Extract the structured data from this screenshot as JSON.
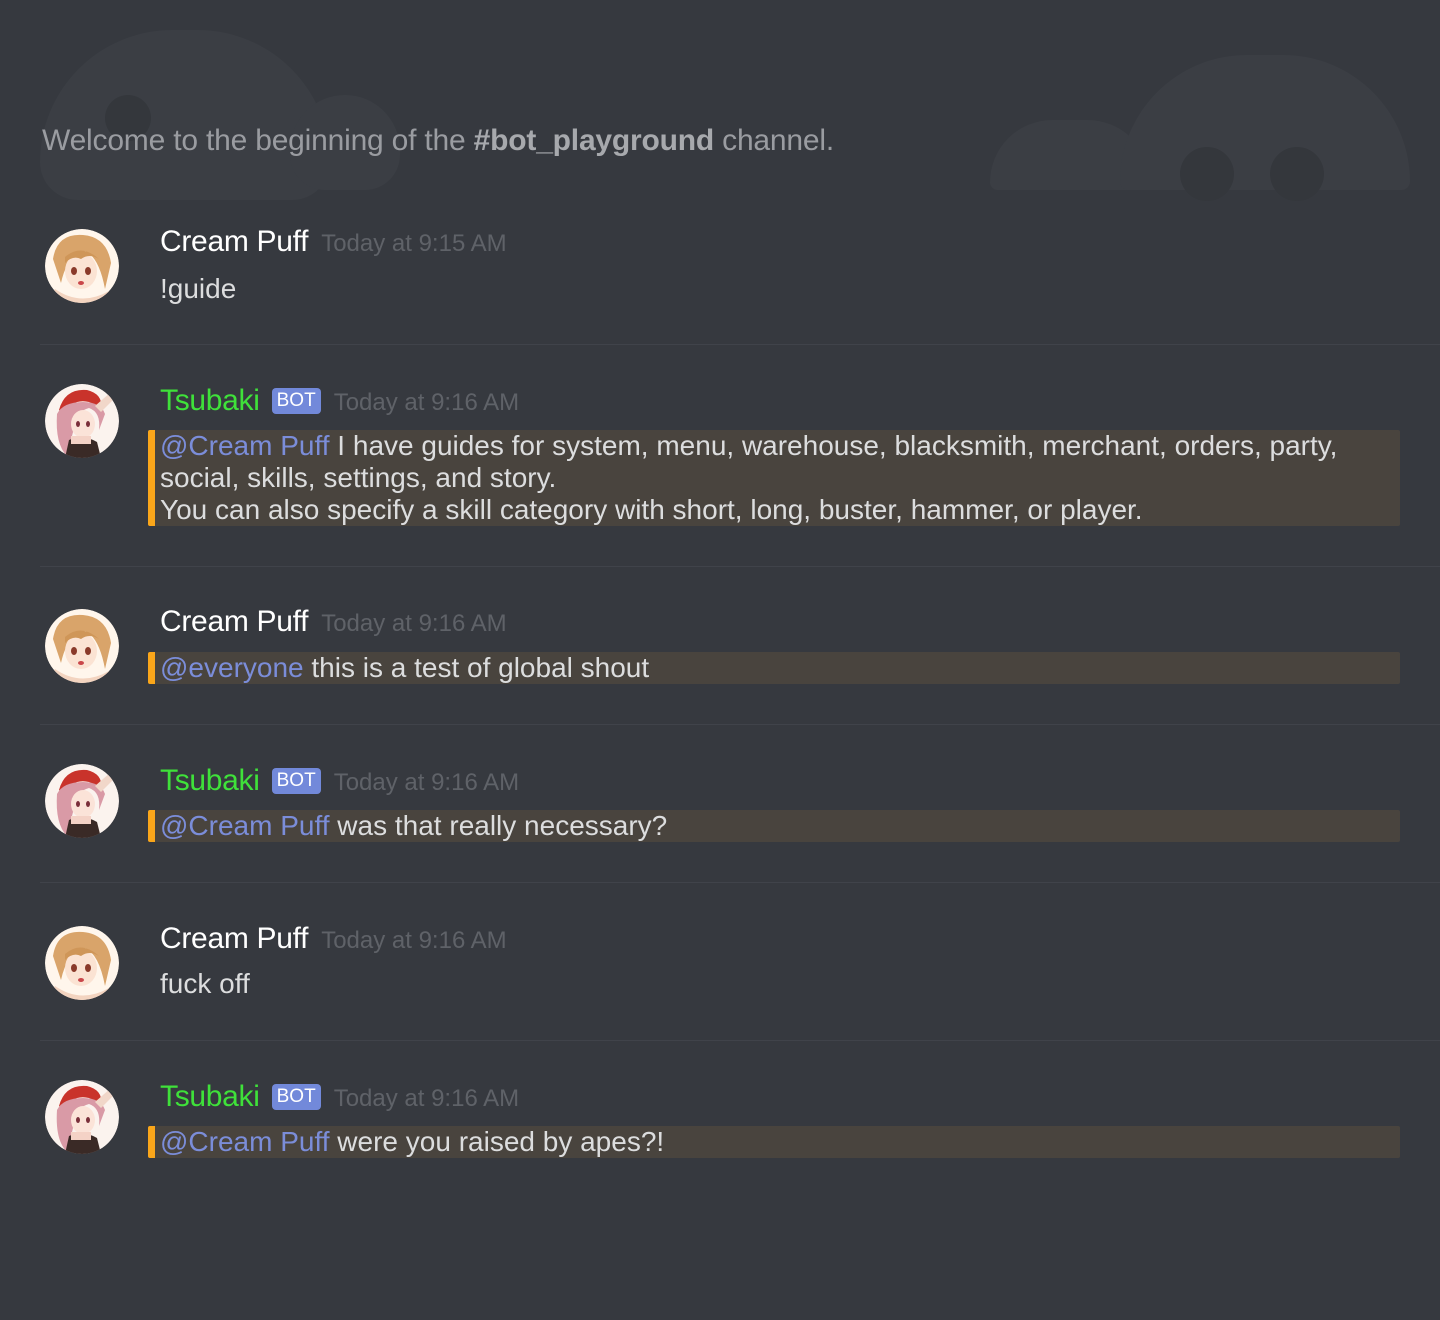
{
  "channel": {
    "welcome_prefix": "Welcome to the beginning of the ",
    "channel_name": "#bot_playground",
    "welcome_suffix": " channel."
  },
  "colors": {
    "background": "#36393f",
    "bot_name": "#3fe13a",
    "bot_tag": "#7289da",
    "mention": "#7b8dd9",
    "highlight_bar": "#faa61a",
    "highlight_bg": "#49443e"
  },
  "messages": [
    {
      "author": "Cream Puff",
      "avatar": "cream-puff-avatar",
      "timestamp": "Today at 9:15 AM",
      "text": "!guide"
    },
    {
      "author": "Tsubaki",
      "bot_tag": "BOT",
      "avatar": "tsubaki-avatar",
      "timestamp": "Today at 9:16 AM",
      "mention": "@Cream Puff",
      "line1": " I have guides for system, menu, warehouse, blacksmith, merchant, orders, party,",
      "line2": "social, skills, settings, and story.",
      "line3": "You can also specify a skill category with short, long, buster, hammer, or player."
    },
    {
      "author": "Cream Puff",
      "avatar": "cream-puff-avatar",
      "timestamp": "Today at 9:16 AM",
      "mention": "@everyone",
      "text": " this is a test of global shout"
    },
    {
      "author": "Tsubaki",
      "bot_tag": "BOT",
      "avatar": "tsubaki-avatar",
      "timestamp": "Today at 9:16 AM",
      "mention": "@Cream Puff",
      "text": " was that really necessary?"
    },
    {
      "author": "Cream Puff",
      "avatar": "cream-puff-avatar",
      "timestamp": "Today at 9:16 AM",
      "text": "fuck off"
    },
    {
      "author": "Tsubaki",
      "bot_tag": "BOT",
      "avatar": "tsubaki-avatar",
      "timestamp": "Today at 9:16 AM",
      "mention": "@Cream Puff",
      "text": " were you raised by apes?!"
    }
  ]
}
